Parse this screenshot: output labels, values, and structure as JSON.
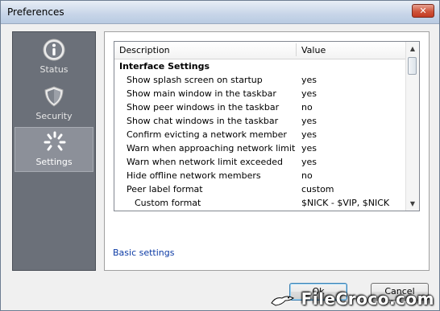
{
  "window": {
    "title": "Preferences",
    "close_glyph": "✕"
  },
  "sidebar": {
    "items": [
      {
        "label": "Status",
        "icon": "info-icon",
        "active": false
      },
      {
        "label": "Security",
        "icon": "shield-icon",
        "active": false
      },
      {
        "label": "Settings",
        "icon": "settings-burst-icon",
        "active": true
      }
    ]
  },
  "grid": {
    "columns": [
      "Description",
      "Value"
    ],
    "rows": [
      {
        "desc": "Interface Settings",
        "value": "",
        "type": "section"
      },
      {
        "desc": "Show splash screen on startup",
        "value": "yes",
        "type": "item"
      },
      {
        "desc": "Show main window in the taskbar",
        "value": "yes",
        "type": "item"
      },
      {
        "desc": "Show peer windows in the taskbar",
        "value": "no",
        "type": "item"
      },
      {
        "desc": "Show chat windows in the taskbar",
        "value": "yes",
        "type": "item"
      },
      {
        "desc": "Confirm evicting a network member",
        "value": "yes",
        "type": "item"
      },
      {
        "desc": "Warn when approaching network limit",
        "value": "yes",
        "type": "item"
      },
      {
        "desc": "Warn when network limit exceeded",
        "value": "yes",
        "type": "item"
      },
      {
        "desc": "Hide offline network members",
        "value": "no",
        "type": "item"
      },
      {
        "desc": "Peer label format",
        "value": "custom",
        "type": "item"
      },
      {
        "desc": "Custom format",
        "value": "$NICK - $VIP, $NICK",
        "type": "child"
      }
    ]
  },
  "links": {
    "basic_settings": "Basic settings"
  },
  "buttons": {
    "ok": "Ok",
    "cancel": "Cancel"
  },
  "watermark": "FileCroco.com",
  "colors": {
    "sidebar_bg": "#6b7079",
    "link": "#0b3aa5",
    "close": "#c23a22"
  }
}
